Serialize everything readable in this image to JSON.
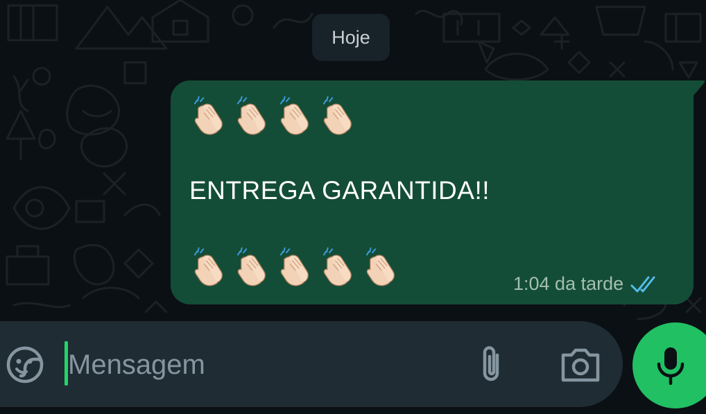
{
  "chat": {
    "date_separator": "Hoje",
    "message": {
      "emoji_row_1": [
        "clapping-hands-emoji",
        "clapping-hands-emoji",
        "clapping-hands-emoji",
        "clapping-hands-emoji"
      ],
      "text": "ENTREGA GARANTIDA!!",
      "emoji_row_2": [
        "clapping-hands-emoji",
        "clapping-hands-emoji",
        "clapping-hands-emoji",
        "clapping-hands-emoji",
        "clapping-hands-emoji"
      ],
      "time": "1:04 da tarde",
      "status_icon": "double-check-read-icon"
    }
  },
  "composer": {
    "placeholder": "Mensagem",
    "sticker_icon": "sticker-icon",
    "attach_icon": "paperclip-icon",
    "camera_icon": "camera-icon",
    "mic_icon": "microphone-icon"
  },
  "colors": {
    "background": "#0b1014",
    "outgoing_bubble": "#144d37",
    "date_chip": "#182229",
    "composer": "#1f2c34",
    "accent": "#21c063",
    "read_ticks": "#53bdeb"
  }
}
